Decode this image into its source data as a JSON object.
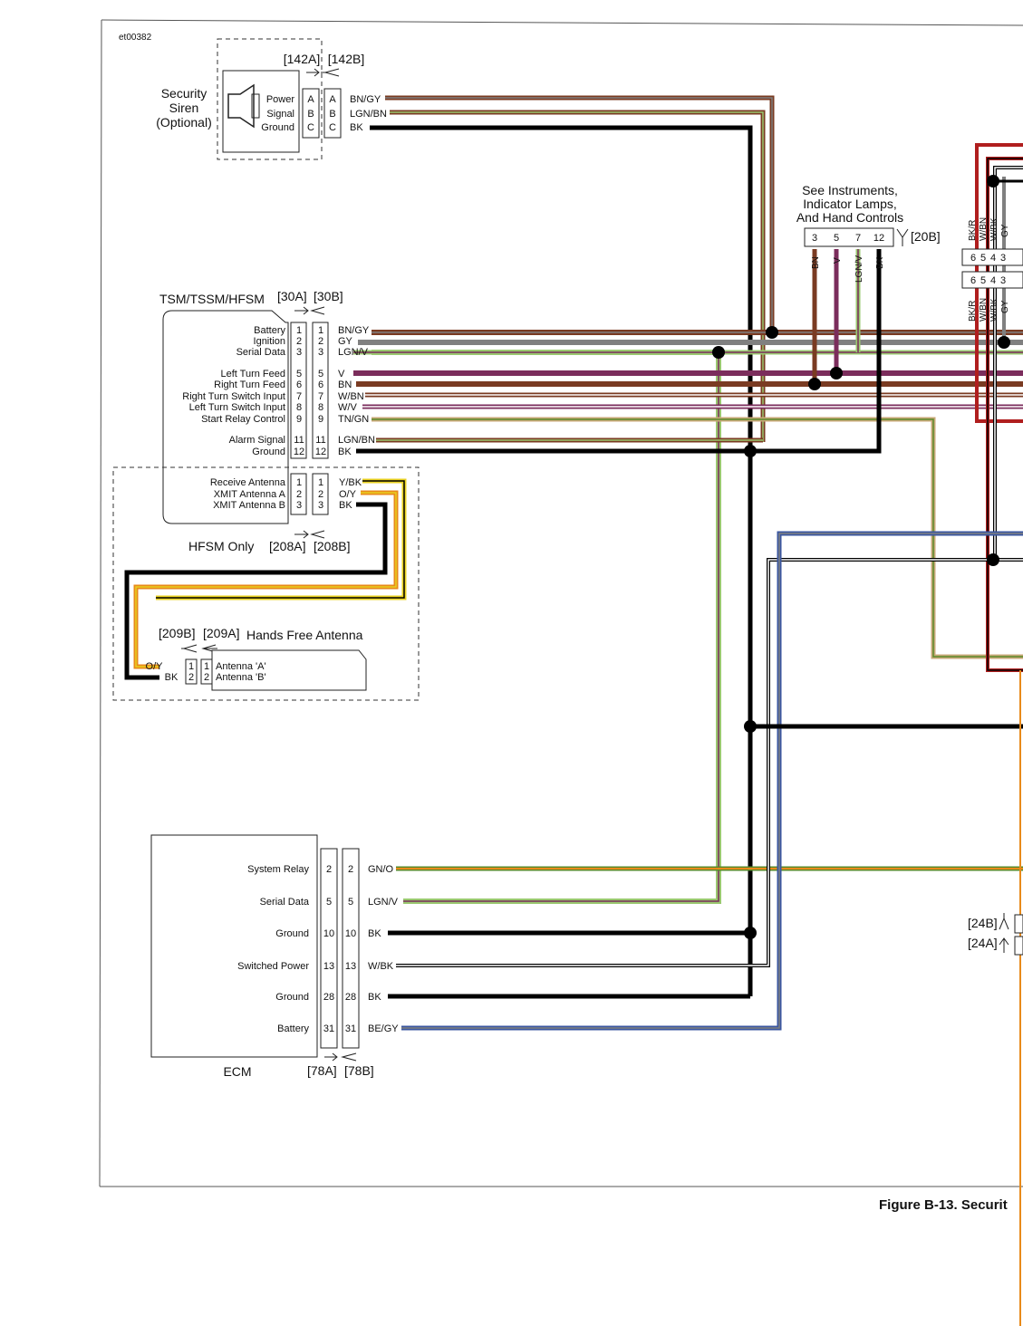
{
  "figure_id": "et00382",
  "figure_caption": "Figure B-13. Securit",
  "siren": {
    "title_lines": [
      "Security",
      "Siren",
      "(Optional)"
    ],
    "conn_a": "[142A]",
    "conn_b": "[142B]",
    "pins": [
      {
        "name": "Power",
        "pin": "A",
        "wire": "BN/GY"
      },
      {
        "name": "Signal",
        "pin": "B",
        "wire": "LGN/BN"
      },
      {
        "name": "Ground",
        "pin": "C",
        "wire": "BK"
      }
    ]
  },
  "tsm": {
    "title": "TSM/TSSM/HFSM",
    "conn_a": "[30A]",
    "conn_b": "[30B]",
    "pins": [
      {
        "name": "Battery",
        "pin": "1",
        "wire": "BN/GY"
      },
      {
        "name": "Ignition",
        "pin": "2",
        "wire": "GY"
      },
      {
        "name": "Serial Data",
        "pin": "3",
        "wire": "LGN/V"
      },
      {
        "name": "Left Turn Feed",
        "pin": "5",
        "wire": "V"
      },
      {
        "name": "Right Turn Feed",
        "pin": "6",
        "wire": "BN"
      },
      {
        "name": "Right Turn Switch Input",
        "pin": "7",
        "wire": "W/BN"
      },
      {
        "name": "Left Turn Switch Input",
        "pin": "8",
        "wire": "W/V"
      },
      {
        "name": "Start Relay Control",
        "pin": "9",
        "wire": "TN/GN"
      },
      {
        "name": "Alarm Signal",
        "pin": "11",
        "wire": "LGN/BN"
      },
      {
        "name": "Ground",
        "pin": "12",
        "wire": "BK"
      }
    ],
    "hfsm_pins": [
      {
        "name": "Receive Antenna",
        "pin": "1",
        "wire": "Y/BK"
      },
      {
        "name": "XMIT Antenna A",
        "pin": "2",
        "wire": "O/Y"
      },
      {
        "name": "XMIT Antenna B",
        "pin": "3",
        "wire": "BK"
      }
    ],
    "hfsm_label": "HFSM Only",
    "hfsm_conn_a": "[208A]",
    "hfsm_conn_b": "[208B]"
  },
  "antenna": {
    "conn_b": "[209B]",
    "conn_a": "[209A]",
    "title": "Hands Free Antenna",
    "pins": [
      {
        "wire": "O/Y",
        "pin": "1",
        "name": "Antenna 'A'"
      },
      {
        "wire": "BK",
        "pin": "2",
        "name": "Antenna 'B'"
      }
    ]
  },
  "instruments": {
    "title_lines": [
      "See Instruments,",
      "Indicator Lamps,",
      "And Hand Controls"
    ],
    "conn": "[20B]",
    "pins": [
      "3",
      "5",
      "7",
      "12"
    ],
    "wires": [
      "BN",
      "V",
      "LGN/V",
      "BK"
    ]
  },
  "right_conn": {
    "wires": [
      "BK/R",
      "W/BN",
      "W/BK",
      "GY"
    ],
    "pins": [
      "6",
      "5",
      "4",
      "3"
    ],
    "conn_b": "[24B]",
    "conn_a": "[24A]"
  },
  "ecm": {
    "title": "ECM",
    "conn_a": "[78A]",
    "conn_b": "[78B]",
    "pins": [
      {
        "name": "System Relay",
        "pin": "2",
        "wire": "GN/O"
      },
      {
        "name": "Serial Data",
        "pin": "5",
        "wire": "LGN/V"
      },
      {
        "name": "Ground",
        "pin": "10",
        "wire": "BK"
      },
      {
        "name": "Switched Power",
        "pin": "13",
        "wire": "W/BK"
      },
      {
        "name": "Ground",
        "pin": "28",
        "wire": "BK"
      },
      {
        "name": "Battery",
        "pin": "31",
        "wire": "BE/GY"
      }
    ]
  },
  "colors": {
    "BN": "#7a3b22",
    "GY": "#808080",
    "V": "#7b2d5c",
    "BK": "#000000",
    "O": "#e88a1a",
    "Y": "#e8d020",
    "BE": "#3a56a0",
    "R": "#b01e1e",
    "GN": "#5a8a2a",
    "LGN": "#9ac870",
    "W": "#ffffff",
    "TN": "#c8a878"
  }
}
